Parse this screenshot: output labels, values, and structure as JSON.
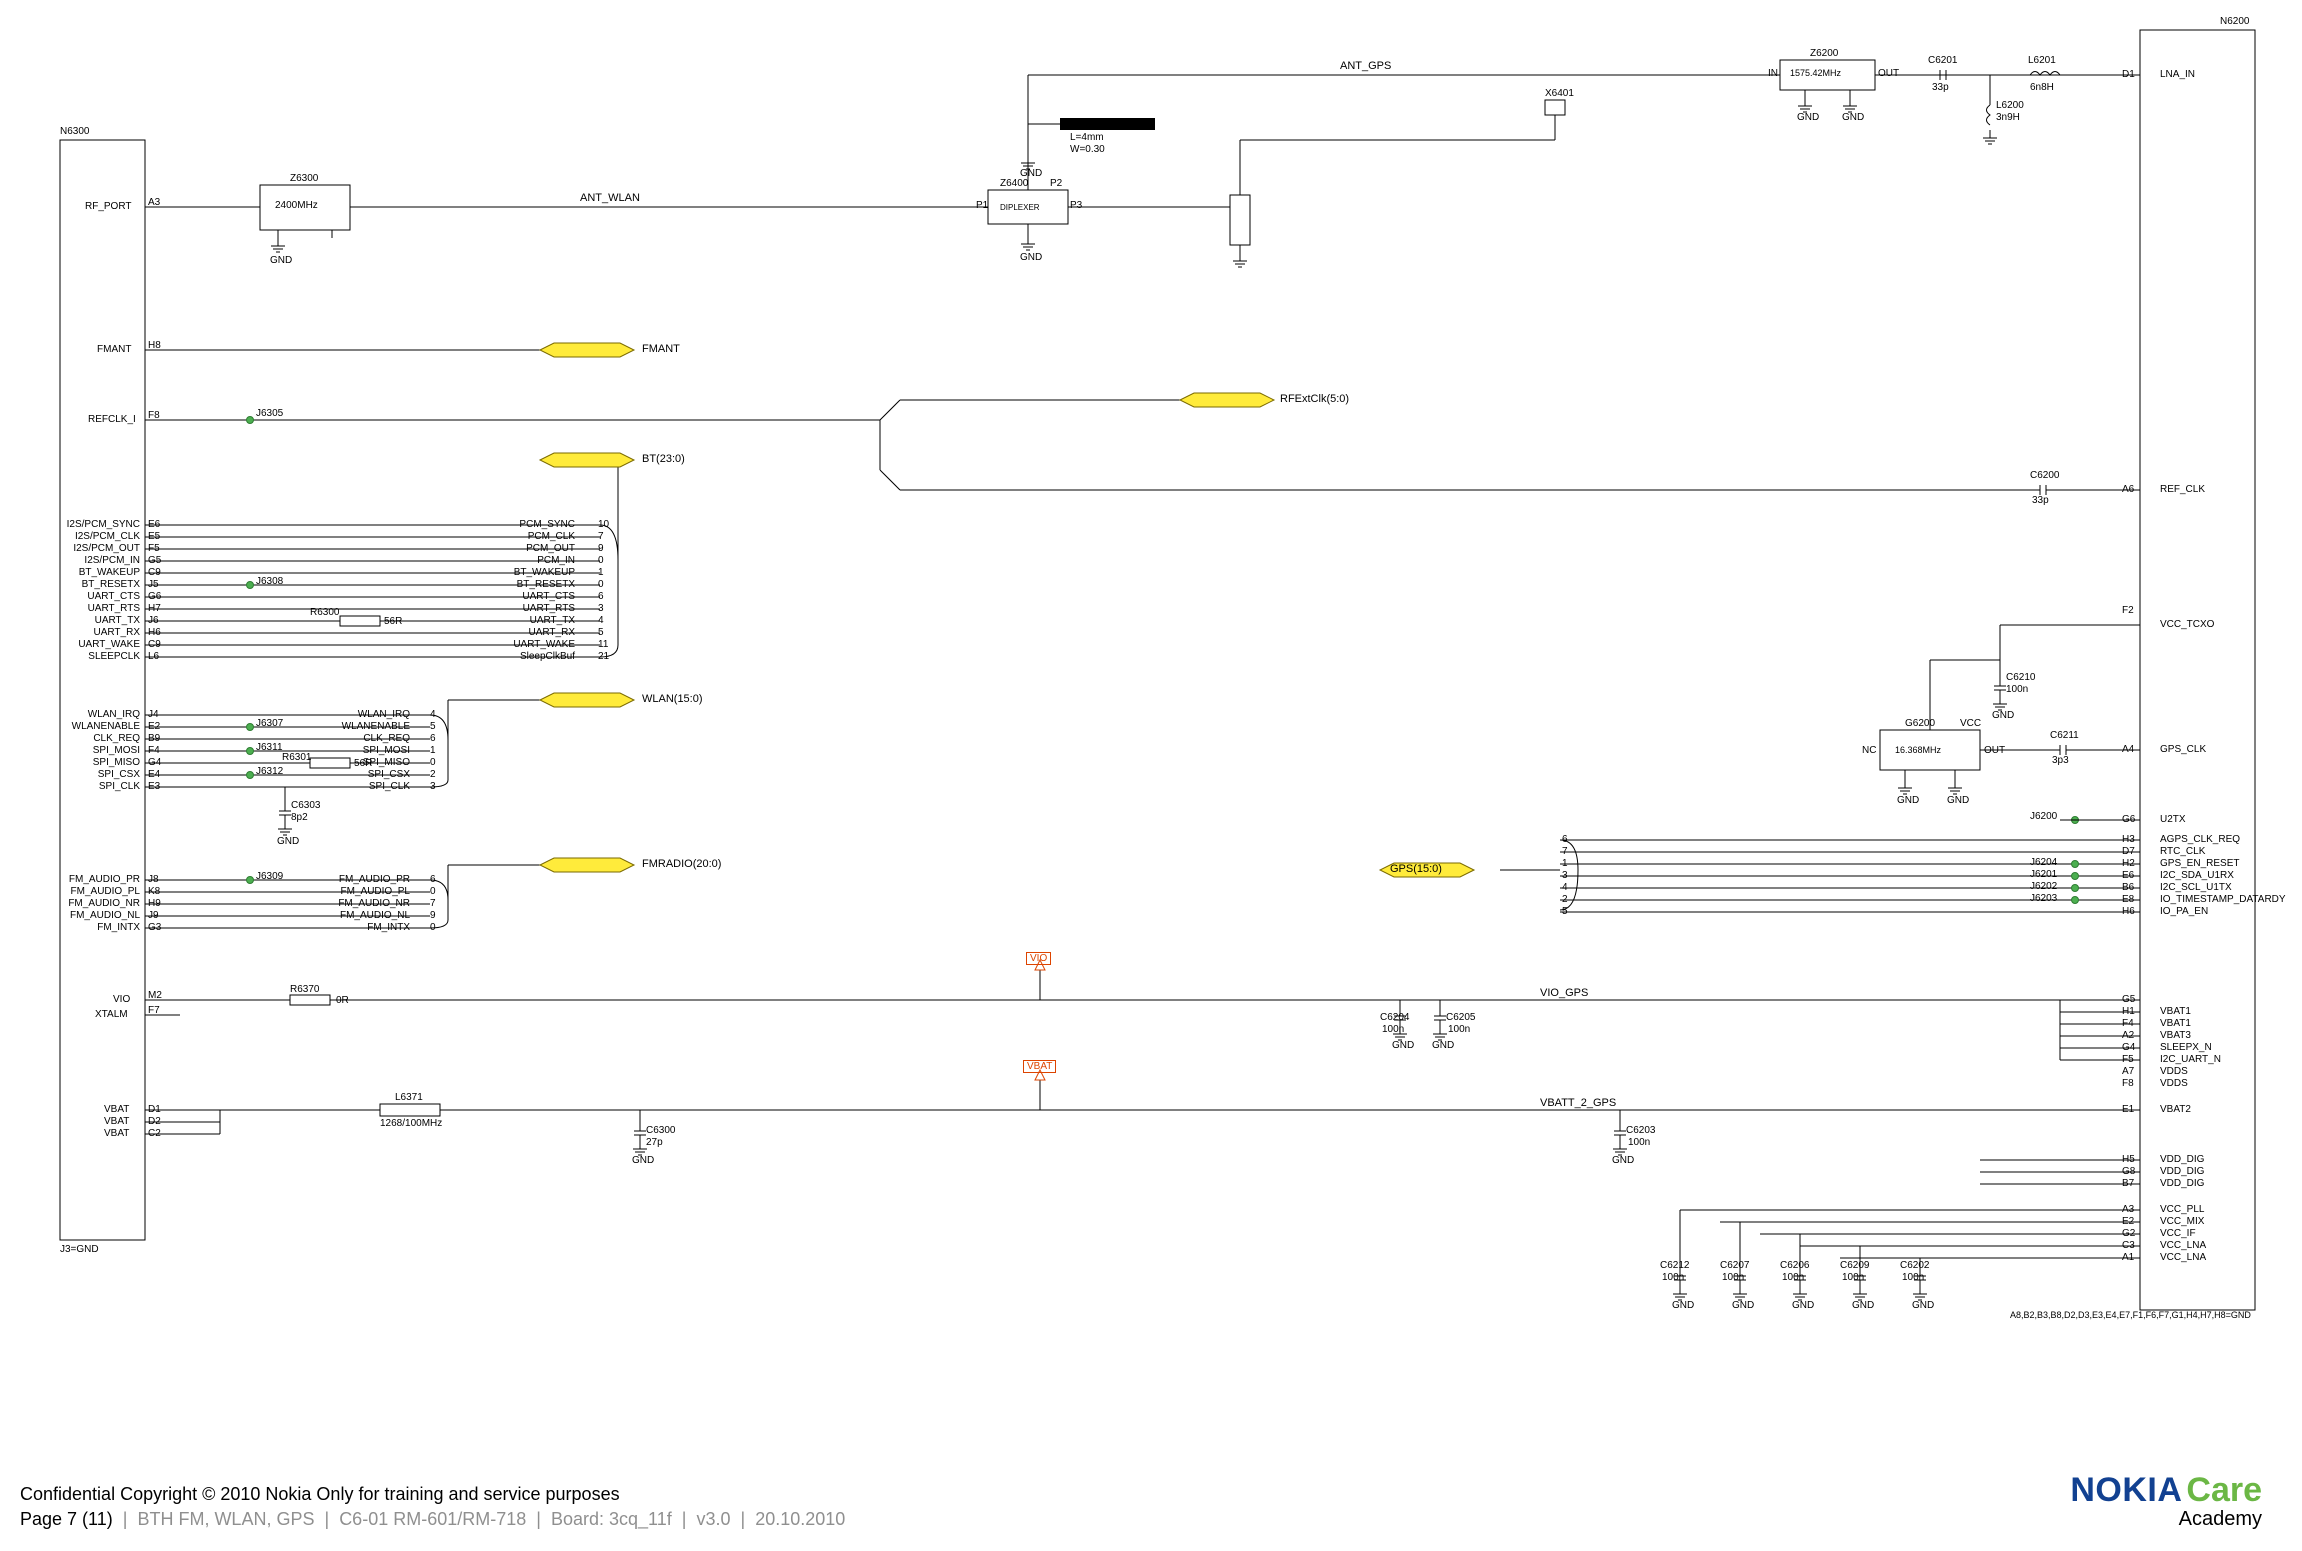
{
  "footer": {
    "copyright": "Confidential Copyright © 2010 Nokia Only for training and service purposes",
    "page": "Page 7 (11)",
    "title": "BTH FM, WLAN, GPS",
    "model": "C6-01 RM-601/RM-718",
    "board": "Board: 3cq_11f",
    "ver": "v3.0",
    "date": "20.10.2010"
  },
  "brand": {
    "name": "NOKIA",
    "care": "Care",
    "academy": "Academy"
  },
  "blocks": {
    "n6300": "N6300",
    "n6200": "N6200",
    "z6300": {
      "ref": "Z6300",
      "val": "2400MHz"
    },
    "z6400": {
      "ref": "Z6400",
      "val": "DIPLEXER",
      "p1": "P1",
      "p2": "P2",
      "p3": "P3"
    },
    "x6401": "X6401",
    "z6200": {
      "ref": "Z6200",
      "val": "1575.42MHz",
      "in": "IN",
      "out": "OUT"
    },
    "g6200": {
      "ref": "G6200",
      "val": "16.368MHz",
      "in": "NC",
      "out": "OUT",
      "vcc": "VCC"
    },
    "c6201": {
      "ref": "C6201",
      "val": "33p"
    },
    "l6201": {
      "ref": "L6201",
      "val": "6n8H"
    },
    "l6200": {
      "ref": "L6200",
      "val": "3n9H"
    },
    "c6200": {
      "ref": "C6200",
      "val": "33p"
    },
    "c6210": {
      "ref": "C6210",
      "val": "100n"
    },
    "c6211": {
      "ref": "C6211",
      "val": "3p3"
    },
    "c6203": {
      "ref": "C6203",
      "val": "100n"
    },
    "c6204": {
      "ref": "C6204",
      "val": "100n"
    },
    "c6205": {
      "ref": "C6205",
      "val": "100n"
    },
    "c6300": {
      "ref": "C6300",
      "val": "27p"
    },
    "c6303": {
      "ref": "C6303",
      "val": "8p2"
    },
    "c6202": {
      "ref": "C6202",
      "val": "100n"
    },
    "c6206": {
      "ref": "C6206",
      "val": "100n"
    },
    "c6207": {
      "ref": "C6207",
      "val": "100n"
    },
    "c6209": {
      "ref": "C6209",
      "val": "100n"
    },
    "c6212": {
      "ref": "C6212",
      "val": "100n"
    },
    "l6371": {
      "ref": "L6371",
      "val": "1268/100MHz"
    },
    "r6370": {
      "ref": "R6370",
      "val": "0R"
    },
    "r6300": {
      "ref": "R6300",
      "val": "56R"
    },
    "r6301": {
      "ref": "R6301",
      "val": "56R"
    },
    "ant_note": {
      "l": "L=4mm",
      "w": "W=0.30"
    }
  },
  "nets": {
    "ant_wlan": "ANT_WLAN",
    "ant_gps": "ANT_GPS",
    "vio": "VIO",
    "vbat": "VBAT",
    "vio_gps": "VIO_GPS",
    "vbatt2": "VBATT_2_GPS",
    "gnd_note": "J3=GND",
    "lna_in": "LNA_IN",
    "ref_clk": "REF_CLK",
    "vcc_txo": "VCC_TCXO",
    "gps_clk": "GPS_CLK",
    "u2tx": "U2TX",
    "vbat2": "VBAT2",
    "gnd_foot": "A8,B2,B3,B8,D2,D3,E3,E4,E7,F1,F6,F7,G1,H4,H7,H8=GND"
  },
  "busses": {
    "fmant": "FMANT",
    "rfextclk": "RFExtClk(5:0)",
    "bt": "BT(23:0)",
    "wlan": "WLAN(15:0)",
    "fmradio": "FMRADIO(20:0)",
    "gps": "GPS(15:0)"
  },
  "left_block_labels": {
    "rf_port": "RF_PORT",
    "fmant": "FMANT",
    "refclk": "REFCLK_I",
    "bt": [
      {
        "pin": "E6",
        "name": "I2S/PCM_SYNC",
        "far": "PCM_SYNC",
        "num": "10"
      },
      {
        "pin": "E5",
        "name": "I2S/PCM_CLK",
        "far": "PCM_CLK",
        "num": "7"
      },
      {
        "pin": "F5",
        "name": "I2S/PCM_OUT",
        "far": "PCM_OUT",
        "num": "9"
      },
      {
        "pin": "G5",
        "name": "I2S/PCM_IN",
        "far": "PCM_IN",
        "num": "0"
      },
      {
        "pin": "C9",
        "name": "BT_WAKEUP",
        "far": "BT_WAKEUP",
        "num": "1"
      },
      {
        "pin": "J5",
        "name": "BT_RESETX",
        "far": "BT_RESETX",
        "num": "0"
      },
      {
        "pin": "G6",
        "name": "UART_CTS",
        "far": "UART_CTS",
        "num": "6"
      },
      {
        "pin": "H7",
        "name": "UART_RTS",
        "far": "UART_RTS",
        "num": "3"
      },
      {
        "pin": "J6",
        "name": "UART_TX",
        "far": "UART_TX",
        "num": "4"
      },
      {
        "pin": "H6",
        "name": "UART_RX",
        "far": "UART_RX",
        "num": "5"
      },
      {
        "pin": "C9",
        "name": "UART_WAKE",
        "far": "UART_WAKE",
        "num": "11"
      },
      {
        "pin": "L6",
        "name": "SLEEPCLK",
        "far": "SleepClkBuf",
        "num": "21"
      }
    ],
    "wlan": [
      {
        "pin": "J4",
        "name": "WLAN_IRQ",
        "far": "WLAN_IRQ",
        "num": "4"
      },
      {
        "pin": "E2",
        "name": "WLANENABLE",
        "far": "WLANENABLE",
        "num": "5"
      },
      {
        "pin": "B9",
        "name": "CLK_REQ",
        "far": "CLK_REQ",
        "num": "6"
      },
      {
        "pin": "F4",
        "name": "SPI_MOSI",
        "far": "SPI_MOSI",
        "num": "1"
      },
      {
        "pin": "G4",
        "name": "SPI_MISO",
        "far": "SPI_MISO",
        "num": "0"
      },
      {
        "pin": "E4",
        "name": "SPI_CSX",
        "far": "SPI_CSX",
        "num": "2"
      },
      {
        "pin": "E3",
        "name": "SPI_CLK",
        "far": "SPI_CLK",
        "num": "3"
      }
    ],
    "fm": [
      {
        "pin": "J8",
        "name": "FM_AUDIO_PR",
        "far": "FM_AUDIO_PR",
        "num": "6"
      },
      {
        "pin": "K8",
        "name": "FM_AUDIO_PL",
        "far": "FM_AUDIO_PL",
        "num": "0"
      },
      {
        "pin": "H9",
        "name": "FM_AUDIO_NR",
        "far": "FM_AUDIO_NR",
        "num": "7"
      },
      {
        "pin": "J9",
        "name": "FM_AUDIO_NL",
        "far": "FM_AUDIO_NL",
        "num": "9"
      },
      {
        "pin": "G3",
        "name": "FM_INTX",
        "far": "FM_INTX",
        "num": "0"
      }
    ],
    "vio": {
      "pin": "M2",
      "name": "VIO"
    },
    "xtalm": {
      "pin": "F7",
      "name": "XTALM"
    },
    "vbat": [
      {
        "pin": "D1",
        "name": "VBAT"
      },
      {
        "pin": "D2",
        "name": "VBAT"
      },
      {
        "pin": "C2",
        "name": "VBAT"
      }
    ]
  },
  "right_block_labels": {
    "lna": {
      "pin": "D1"
    },
    "refclk": {
      "pin": "A6"
    },
    "vcc_tcxo": {
      "pin": "F2"
    },
    "gps_clk": {
      "pin": "A4"
    },
    "u2tx": {
      "pin": "G6"
    },
    "gps_bus": [
      {
        "pin": "H3",
        "name": "AGPS_CLK_REQ",
        "num": "6"
      },
      {
        "pin": "D7",
        "name": "RTC_CLK",
        "num": "7"
      },
      {
        "pin": "H2",
        "name": "GPS_EN_RESET",
        "num": "1"
      },
      {
        "pin": "E6",
        "name": "I2C_SDA_U1RX",
        "num": "3"
      },
      {
        "pin": "B6",
        "name": "I2C_SCL_U1TX",
        "num": "4"
      },
      {
        "pin": "E8",
        "name": "IO_TIMESTAMP_DATARDY",
        "num": "2"
      },
      {
        "pin": "H6",
        "name": "IO_PA_EN",
        "num": "5"
      }
    ],
    "vbat_group": [
      {
        "pin": "G5",
        "name": ""
      },
      {
        "pin": "H1",
        "name": "VBAT1"
      },
      {
        "pin": "F4",
        "name": "VBAT1"
      },
      {
        "pin": "A2",
        "name": "VBAT3"
      },
      {
        "pin": "G4",
        "name": "SLEEPX_N"
      },
      {
        "pin": "F5",
        "name": "I2C_UART_N"
      },
      {
        "pin": "A7",
        "name": "VDDS"
      },
      {
        "pin": "F8",
        "name": "VDDS"
      }
    ],
    "vbat2": {
      "pin": "E1"
    },
    "vdd": [
      {
        "pin": "H5",
        "name": "VDD_DIG"
      },
      {
        "pin": "G8",
        "name": "VDD_DIG"
      },
      {
        "pin": "B7",
        "name": "VDD_DIG"
      }
    ],
    "vcc": [
      {
        "pin": "A3",
        "name": "VCC_PLL"
      },
      {
        "pin": "E2",
        "name": "VCC_MIX"
      },
      {
        "pin": "G2",
        "name": "VCC_IF"
      },
      {
        "pin": "C3",
        "name": "VCC_LNA"
      },
      {
        "pin": "A1",
        "name": "VCC_LNA"
      }
    ]
  },
  "jumpers": {
    "j6305": "J6305",
    "j6308": "J6308",
    "j6307": "J6307",
    "j6311": "J6311",
    "j6312": "J6312",
    "j6309": "J6309",
    "j6200": "J6200",
    "j6201": "J6201",
    "j6202": "J6202",
    "j6203": "J6203",
    "j6204": "J6204"
  },
  "gnd": "GND"
}
